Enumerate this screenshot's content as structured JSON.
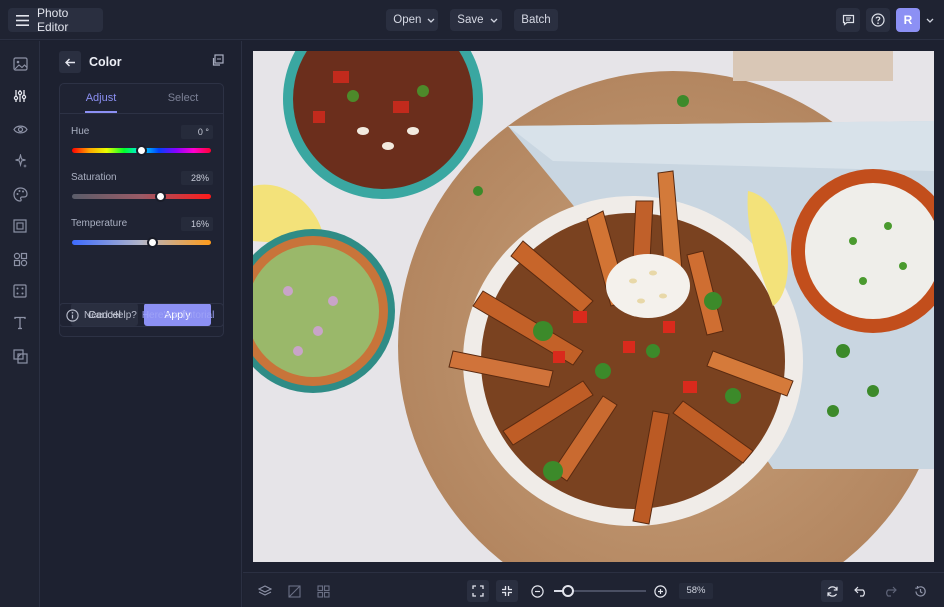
{
  "app": {
    "menu_label": "Photo Editor"
  },
  "top_menu": {
    "open_label": "Open",
    "save_label": "Save",
    "batch_label": "Batch"
  },
  "user": {
    "initial": "R"
  },
  "rail": {
    "items": [
      {
        "icon": "image-icon"
      },
      {
        "icon": "adjust-sliders-icon",
        "active": true
      },
      {
        "icon": "eye-icon"
      },
      {
        "icon": "magic-wand-icon"
      },
      {
        "icon": "palette-icon"
      },
      {
        "icon": "frame-icon"
      },
      {
        "icon": "graphics-icon"
      },
      {
        "icon": "texture-icon"
      },
      {
        "icon": "text-icon"
      },
      {
        "icon": "overlay-icon"
      }
    ]
  },
  "panel": {
    "title": "Color",
    "tabs": [
      "Adjust",
      "Select"
    ],
    "active_tab": "Adjust",
    "sliders": [
      {
        "label": "Hue",
        "value_text": "0 °",
        "value": 0,
        "min": -180,
        "max": 180
      },
      {
        "label": "Saturation",
        "value_text": "28%",
        "value": 28,
        "min": -100,
        "max": 100
      },
      {
        "label": "Temperature",
        "value_text": "16%",
        "value": 16,
        "min": -100,
        "max": 100
      }
    ],
    "cancel_label": "Cancel",
    "apply_label": "Apply",
    "help_text": "Need Help?",
    "help_link": "Here's a Tutorial"
  },
  "zoom": {
    "value_text": "58%",
    "level": 0.15
  },
  "colors": {
    "accent": "#8c90f4",
    "background": "#1d2130",
    "panel": "#1f2332"
  }
}
